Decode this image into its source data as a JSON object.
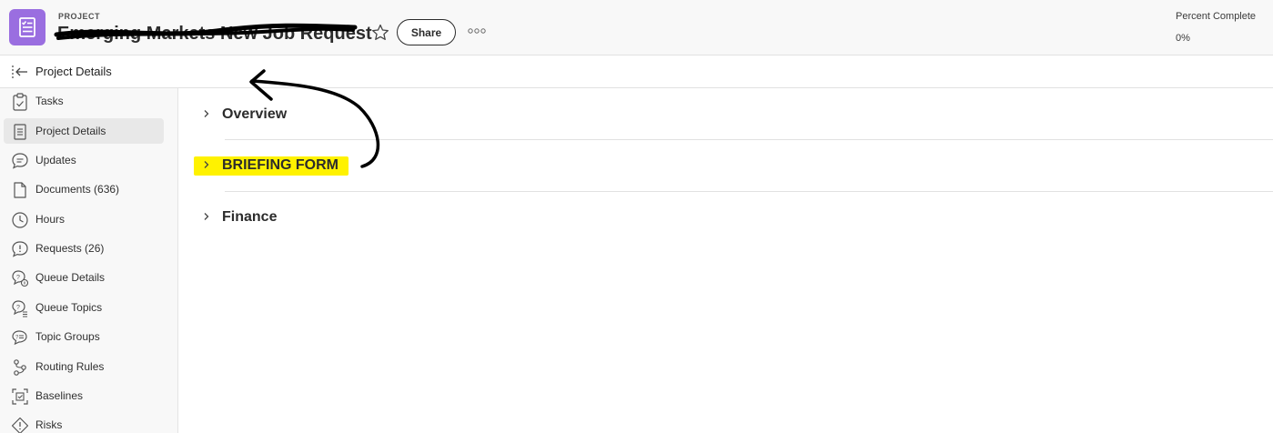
{
  "header": {
    "eyebrow": "PROJECT",
    "title": "Emerging Markets New Job Request",
    "share_label": "Share",
    "percent_complete_label": "Percent Complete",
    "percent_complete_value": "0%",
    "project_icon": "checklist-icon",
    "star_icon": "star-icon",
    "more_icon": "more-options-icon"
  },
  "subheader": {
    "title": "Project Details",
    "icon": "collapse-panel-icon"
  },
  "sidebar": {
    "items": [
      {
        "label": "Tasks",
        "icon": "clipboard-check-icon"
      },
      {
        "label": "Project Details",
        "icon": "document-icon",
        "active": true
      },
      {
        "label": "Updates",
        "icon": "comment-icon"
      },
      {
        "label": "Documents (636)",
        "icon": "file-icon"
      },
      {
        "label": "Hours",
        "icon": "clock-icon"
      },
      {
        "label": "Requests (26)",
        "icon": "request-alert-icon"
      },
      {
        "label": "Queue Details",
        "icon": "queue-details-icon"
      },
      {
        "label": "Queue Topics",
        "icon": "queue-topics-icon"
      },
      {
        "label": "Topic Groups",
        "icon": "topic-groups-icon"
      },
      {
        "label": "Routing Rules",
        "icon": "routing-icon"
      },
      {
        "label": "Baselines",
        "icon": "baseline-icon"
      },
      {
        "label": "Risks",
        "icon": "risk-diamond-icon"
      }
    ]
  },
  "main": {
    "sections": [
      {
        "title": "Overview"
      },
      {
        "title": "BRIEFING FORM",
        "highlighted": true
      },
      {
        "title": "Finance"
      }
    ]
  },
  "colors": {
    "brand_purple": "#9a6ee0",
    "highlight_yellow": "#fff200",
    "active_nav": "#e8e8e8"
  }
}
